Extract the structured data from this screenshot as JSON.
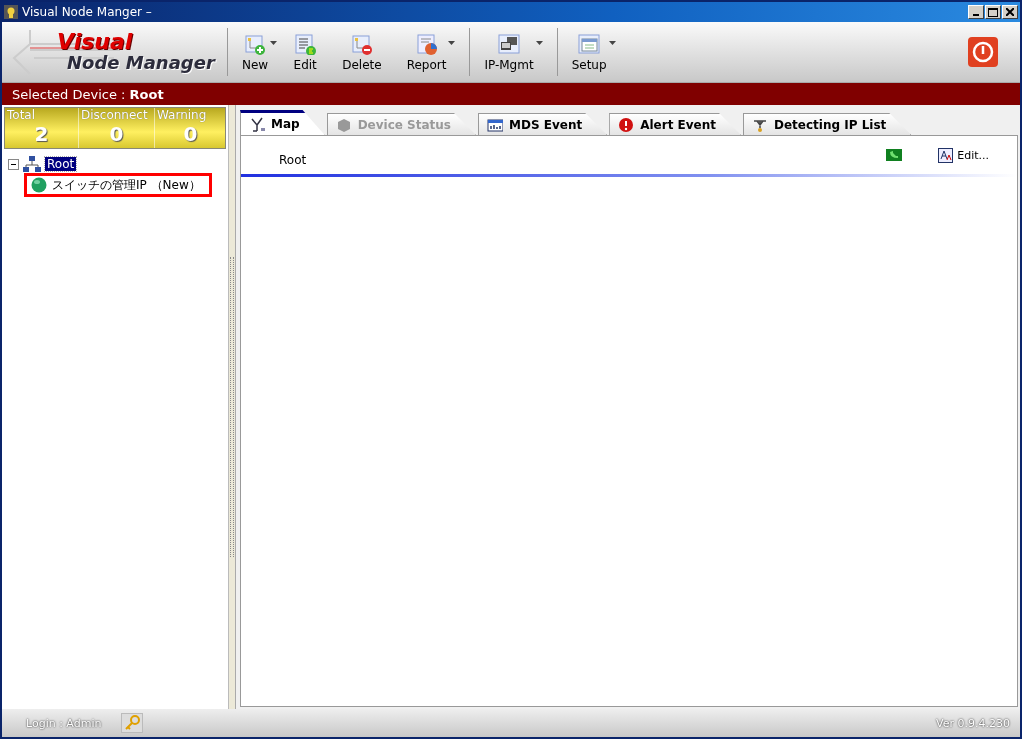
{
  "window": {
    "title": "Visual Node Manger –"
  },
  "logo": {
    "line1": "Visual",
    "line2": "Node Manager"
  },
  "toolbar": [
    [
      {
        "label": "New",
        "dropdown": true
      },
      {
        "label": "Edit",
        "dropdown": false
      },
      {
        "label": "Delete",
        "dropdown": false
      },
      {
        "label": "Report",
        "dropdown": true
      }
    ],
    [
      {
        "label": "IP-Mgmt",
        "dropdown": true
      }
    ],
    [
      {
        "label": "Setup",
        "dropdown": true
      }
    ]
  ],
  "selected_device": {
    "label": "Selected Device :",
    "value": "Root"
  },
  "stats": [
    {
      "label": "Total",
      "value": "2"
    },
    {
      "label": "Disconnect",
      "value": "0"
    },
    {
      "label": "Warning",
      "value": "0"
    }
  ],
  "tree": [
    {
      "label": "Root",
      "selected": true,
      "expanded": true,
      "highlighted": false,
      "children": [
        {
          "label": "スイッチの管理IP （New）",
          "selected": false,
          "highlighted": true
        }
      ]
    }
  ],
  "tabs": [
    {
      "label": "Map",
      "kind": "map",
      "selected": true,
      "disabled": false
    },
    {
      "label": "Device Status",
      "kind": "status",
      "selected": false,
      "disabled": true
    },
    {
      "label": "MDS Event",
      "kind": "mds",
      "selected": false,
      "disabled": false
    },
    {
      "label": "Alert Event",
      "kind": "alert",
      "selected": false,
      "disabled": false
    },
    {
      "label": "Detecting IP List",
      "kind": "detect",
      "selected": false,
      "disabled": false
    }
  ],
  "map": {
    "title": "Root",
    "edit_label": "Edit..."
  },
  "status_bar": {
    "login": "Login : Admin",
    "version": "Ver 0.9.4.230"
  }
}
